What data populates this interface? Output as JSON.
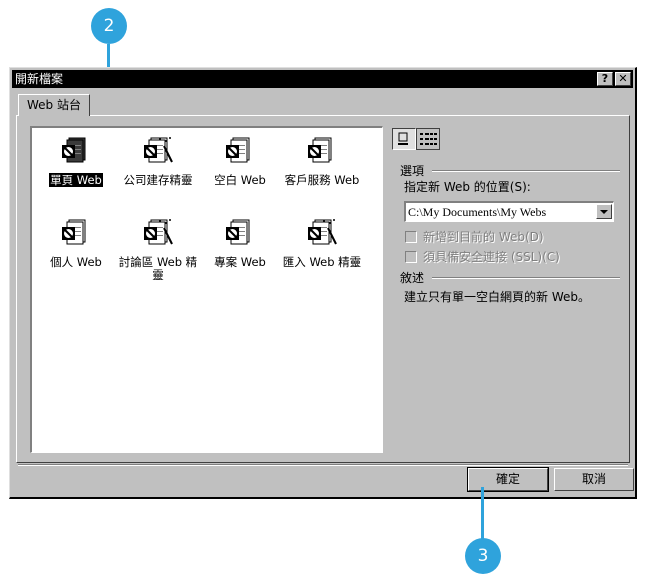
{
  "callouts": {
    "top": "2",
    "bottom": "3"
  },
  "window": {
    "title": "開新檔案",
    "help_label": "?",
    "close_label": "✕"
  },
  "tab": {
    "label": "Web 站台"
  },
  "templates": [
    {
      "label": "單頁 Web",
      "icon": "single-page-web-icon",
      "selected": true
    },
    {
      "label": "公司建存精靈",
      "icon": "corporate-wizard-icon"
    },
    {
      "label": "空白 Web",
      "icon": "empty-web-icon"
    },
    {
      "label": "客戶服務 Web",
      "icon": "customer-support-web-icon"
    },
    {
      "label": "個人 Web",
      "icon": "personal-web-icon"
    },
    {
      "label": "討論區 Web 精靈",
      "icon": "discussion-wizard-icon"
    },
    {
      "label": "專案 Web",
      "icon": "project-web-icon"
    },
    {
      "label": "匯入 Web 精靈",
      "icon": "import-wizard-icon"
    }
  ],
  "options": {
    "heading": "選項",
    "location_label": "指定新 Web 的位置(S):",
    "location_value": "C:\\My Documents\\My Webs",
    "add_to_current": "新增到目前的 Web(D)",
    "secure_connection": "須具備安全連接 (SSL)(C)"
  },
  "description": {
    "heading": "敘述",
    "text": "建立只有單一空白網頁的新 Web。"
  },
  "buttons": {
    "ok": "確定",
    "cancel": "取消"
  }
}
